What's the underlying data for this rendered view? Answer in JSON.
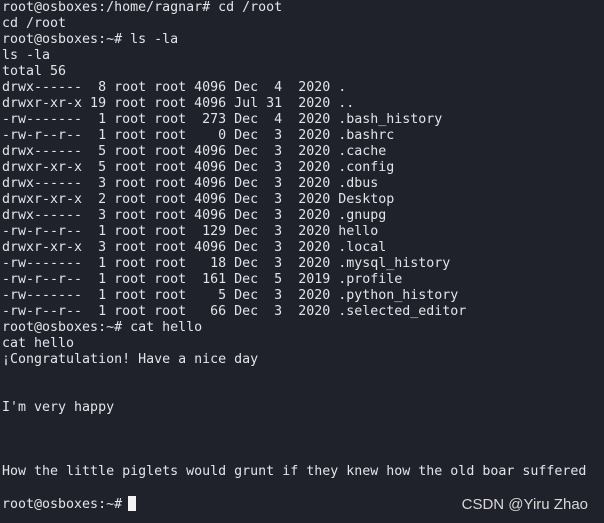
{
  "terminal": {
    "lines": [
      "root@osboxes:/home/ragnar# cd /root",
      "cd /root",
      "root@osboxes:~# ls -la",
      "ls -la",
      "total 56",
      "drwx------  8 root root 4096 Dec  4  2020 .",
      "drwxr-xr-x 19 root root 4096 Jul 31  2020 ..",
      "-rw-------  1 root root  273 Dec  4  2020 .bash_history",
      "-rw-r--r--  1 root root    0 Dec  3  2020 .bashrc",
      "drwx------  5 root root 4096 Dec  3  2020 .cache",
      "drwxr-xr-x  5 root root 4096 Dec  3  2020 .config",
      "drwx------  3 root root 4096 Dec  3  2020 .dbus",
      "drwxr-xr-x  2 root root 4096 Dec  3  2020 Desktop",
      "drwx------  3 root root 4096 Dec  3  2020 .gnupg",
      "-rw-r--r--  1 root root  129 Dec  3  2020 hello",
      "drwxr-xr-x  3 root root 4096 Dec  3  2020 .local",
      "-rw-------  1 root root   18 Dec  3  2020 .mysql_history",
      "-rw-r--r--  1 root root  161 Dec  5  2019 .profile",
      "-rw-------  1 root root    5 Dec  3  2020 .python_history",
      "-rw-r--r--  1 root root   66 Dec  3  2020 .selected_editor",
      "root@osboxes:~# cat hello",
      "cat hello",
      "¡Congratulation! Have a nice day",
      "",
      "",
      "I'm very happy",
      "",
      "",
      "",
      "How the little piglets would grunt if they knew how the old boar suffered",
      ""
    ],
    "prompt": "root@osboxes:~#"
  },
  "watermark": "CSDN @Yiru Zhao"
}
